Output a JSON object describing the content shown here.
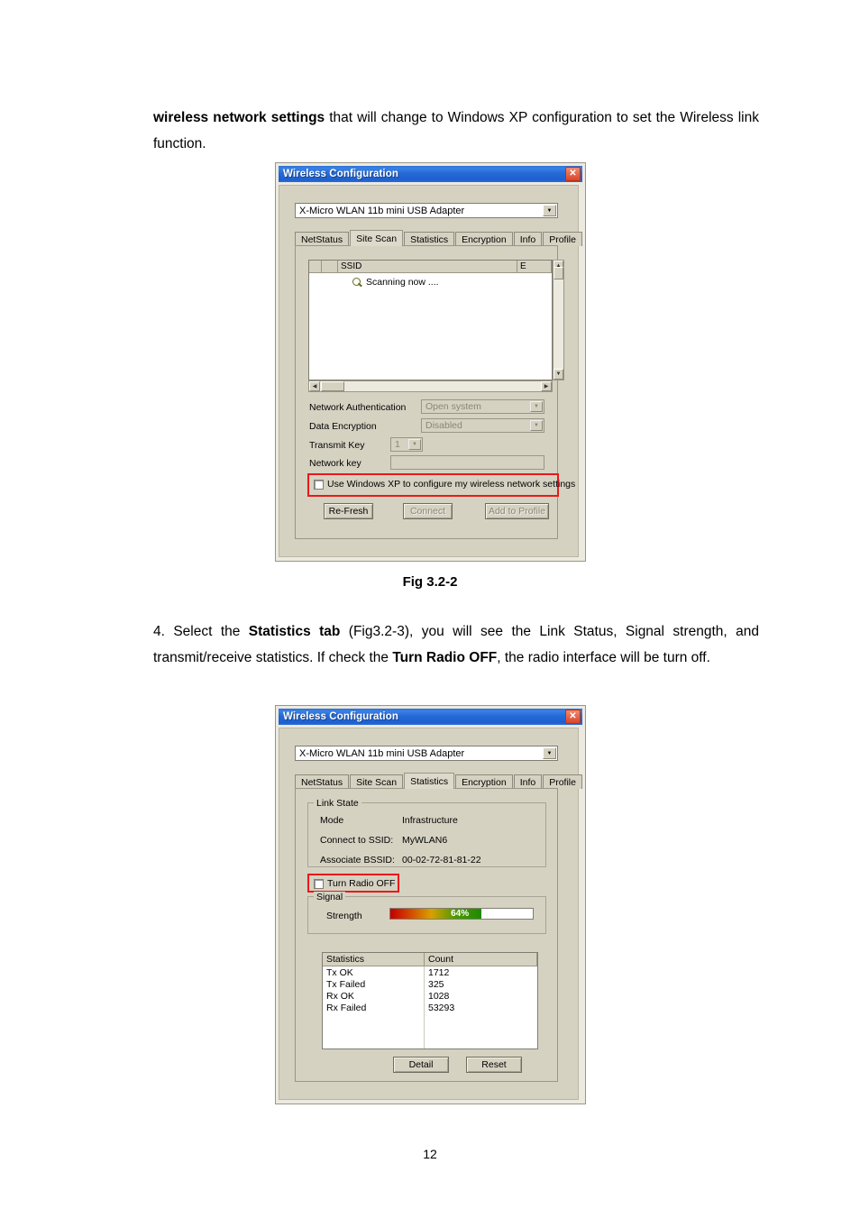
{
  "document": {
    "para1_bold": "wireless network settings",
    "para1_rest": " that will change to Windows XP configuration to set the Wireless link function.",
    "fig_caption": "Fig 3.2-2",
    "para2_a": "4. Select the ",
    "para2_b": "Statistics tab",
    "para2_c": " (Fig3.2-3), you will see the Link Status, Signal strength, and transmit/receive statistics. If check the ",
    "para2_d": "Turn Radio OFF",
    "para2_e": ", the radio interface will be turn off.",
    "page_number": "12"
  },
  "dialog1": {
    "title": "Wireless Configuration",
    "close_label": "✕",
    "adapter": "X-Micro WLAN 11b mini USB Adapter",
    "tabs": [
      {
        "label": "NetStatus",
        "active": false
      },
      {
        "label": "Site Scan",
        "active": true
      },
      {
        "label": "Statistics",
        "active": false
      },
      {
        "label": "Encryption",
        "active": false
      },
      {
        "label": "Info",
        "active": false
      },
      {
        "label": "Profile",
        "active": false
      }
    ],
    "list_headers": [
      "",
      "",
      "SSID",
      "E"
    ],
    "scanning_text": "Scanning now ....",
    "fields": [
      {
        "label": "Network Authentication",
        "value": "Open system"
      },
      {
        "label": "Data Encryption",
        "value": "Disabled"
      },
      {
        "label": "Transmit Key",
        "value": "1"
      },
      {
        "label": "Network key",
        "value": ""
      }
    ],
    "checkbox_label": "Use Windows XP to configure my wireless network settings",
    "buttons": [
      {
        "label": "Re-Fresh",
        "disabled": false
      },
      {
        "label": "Connect",
        "disabled": true
      },
      {
        "label": "Add to Profile",
        "disabled": true
      }
    ]
  },
  "dialog2": {
    "title": "Wireless Configuration",
    "close_label": "✕",
    "adapter": "X-Micro WLAN 11b mini USB Adapter",
    "tabs": [
      {
        "label": "NetStatus",
        "active": false
      },
      {
        "label": "Site Scan",
        "active": false
      },
      {
        "label": "Statistics",
        "active": true
      },
      {
        "label": "Encryption",
        "active": false
      },
      {
        "label": "Info",
        "active": false
      },
      {
        "label": "Profile",
        "active": false
      }
    ],
    "link_state": {
      "legend": "Link State",
      "rows": [
        {
          "label": "Mode",
          "value": "Infrastructure"
        },
        {
          "label": "Connect to SSID:",
          "value": "MyWLAN6"
        },
        {
          "label": "Associate BSSID:",
          "value": "00-02-72-81-81-22"
        }
      ]
    },
    "radio_checkbox_label": "Turn Radio OFF",
    "signal": {
      "legend": "Signal",
      "label": "Strength",
      "percent_label": "64%",
      "percent_value": 64
    },
    "stats": {
      "headers": [
        "Statistics",
        "Count"
      ],
      "rows": [
        {
          "name": "Tx OK",
          "count": "1712"
        },
        {
          "name": "Tx Failed",
          "count": "325"
        },
        {
          "name": "Rx OK",
          "count": "1028"
        },
        {
          "name": "Rx Failed",
          "count": "53293"
        }
      ]
    },
    "buttons": [
      {
        "label": "Detail"
      },
      {
        "label": "Reset"
      }
    ]
  },
  "colors": {
    "titlebar_blue": "#2f6fd2",
    "highlight_red": "#e8191b",
    "face": "#d6d2c2"
  }
}
